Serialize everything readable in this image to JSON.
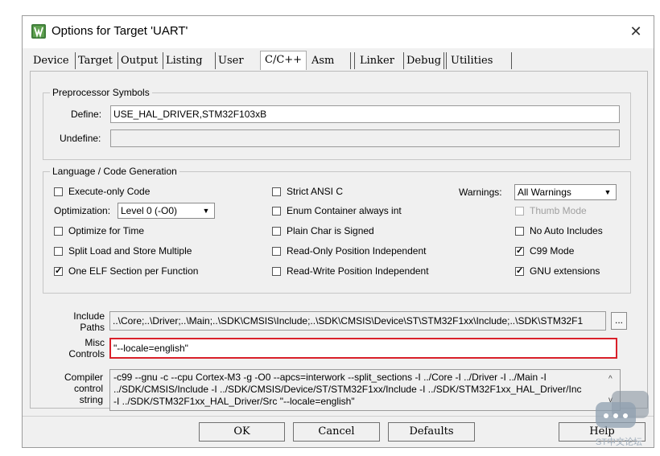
{
  "window": {
    "title": "Options for Target 'UART'",
    "close_glyph": "✕",
    "icon": "keil-uvision-icon"
  },
  "tabs": [
    {
      "label": "Device"
    },
    {
      "label": "Target"
    },
    {
      "label": "Output"
    },
    {
      "label": "Listing"
    },
    {
      "label": "User"
    },
    {
      "label": "C/C++",
      "active": true
    },
    {
      "label": "Asm"
    },
    {
      "label": "Linker"
    },
    {
      "label": "Debug"
    },
    {
      "label": "Utilities"
    }
  ],
  "preprocessor": {
    "title": "Preprocessor Symbols",
    "define_label": "Define:",
    "define_value": "USE_HAL_DRIVER,STM32F103xB",
    "undefine_label": "Undefine:",
    "undefine_value": ""
  },
  "language": {
    "title": "Language / Code Generation",
    "execute_only": {
      "label": "Execute-only Code",
      "checked": false
    },
    "optimization_label": "Optimization:",
    "optimization_value": "Level 0 (-O0)",
    "optimize_time": {
      "label": "Optimize for Time",
      "checked": false
    },
    "split_load": {
      "label": "Split Load and Store Multiple",
      "checked": false
    },
    "one_elf": {
      "label": "One ELF Section per Function",
      "checked": true
    },
    "strict_ansi": {
      "label": "Strict ANSI C",
      "checked": false
    },
    "enum_container": {
      "label": "Enum Container always int",
      "checked": false
    },
    "plain_char": {
      "label": "Plain Char is Signed",
      "checked": false
    },
    "ro_pos": {
      "label": "Read-Only Position Independent",
      "checked": false
    },
    "rw_pos": {
      "label": "Read-Write Position Independent",
      "checked": false
    },
    "warnings_label": "Warnings:",
    "warnings_value": "All Warnings",
    "thumb_mode": {
      "label": "Thumb Mode",
      "checked": false,
      "disabled": true
    },
    "no_auto_includes": {
      "label": "No Auto Includes",
      "checked": false
    },
    "c99_mode": {
      "label": "C99 Mode",
      "checked": true
    },
    "gnu_ext": {
      "label": "GNU extensions",
      "checked": true
    }
  },
  "include": {
    "label_line1": "Include",
    "label_line2": "Paths",
    "value": "..\\Core;..\\Driver;..\\Main;..\\SDK\\CMSIS\\Include;..\\SDK\\CMSIS\\Device\\ST\\STM32F1xx\\Include;..\\SDK\\STM32F1",
    "browse_label": "..."
  },
  "misc": {
    "label_line1": "Misc",
    "label_line2": "Controls",
    "value": "\"--locale=english\""
  },
  "compiler": {
    "label_line1": "Compiler",
    "label_line2": "control",
    "label_line3": "string",
    "line1": "-c99 --gnu -c --cpu Cortex-M3 -g -O0 --apcs=interwork --split_sections -I ../Core -I ../Driver -I ../Main -I",
    "line2": "../SDK/CMSIS/Include -I ../SDK/CMSIS/Device/ST/STM32F1xx/Include -I ../SDK/STM32F1xx_HAL_Driver/Inc",
    "line3": "-I ../SDK/STM32F1xx_HAL_Driver/Src \"--locale=english\""
  },
  "buttons": {
    "ok": "OK",
    "cancel": "Cancel",
    "defaults": "Defaults",
    "help": "Help"
  },
  "watermark": {
    "text": "ST中文论坛"
  }
}
